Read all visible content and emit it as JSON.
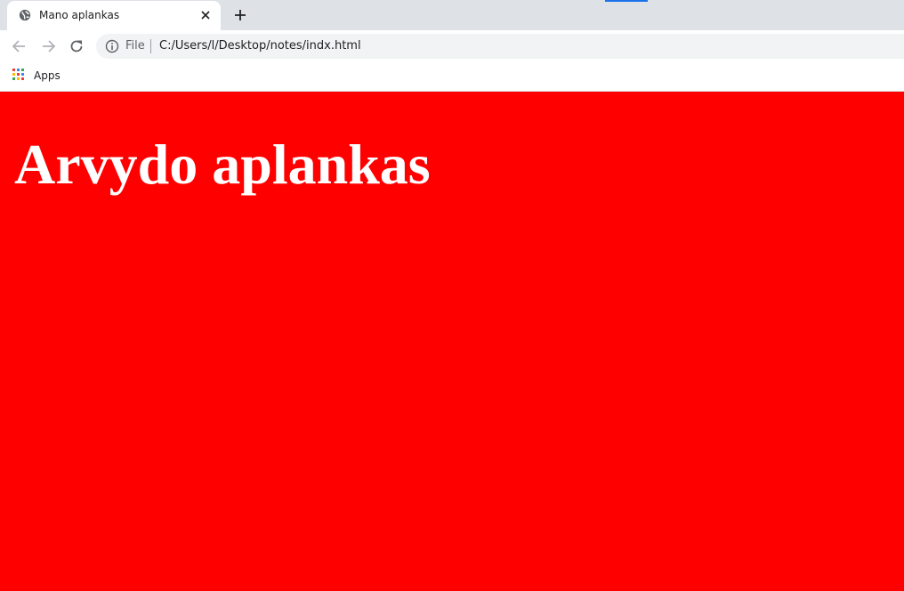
{
  "browser": {
    "tab": {
      "title": "Mano aplankas",
      "favicon": "globe-icon"
    },
    "new_tab_icon": "plus-icon",
    "toolbar": {
      "back_icon": "back-arrow-icon",
      "forward_icon": "forward-arrow-icon",
      "reload_icon": "reload-icon",
      "address": {
        "security_icon": "info-icon",
        "scheme_label": "File",
        "url": "C:/Users/l/Desktop/notes/indx.html"
      }
    },
    "bookmarks_bar": {
      "apps_label": "Apps",
      "apps_icon": "apps-grid-icon"
    }
  },
  "page": {
    "background_color": "#ff0000",
    "heading": "Arvydo aplankas",
    "heading_color": "#ffffff"
  }
}
